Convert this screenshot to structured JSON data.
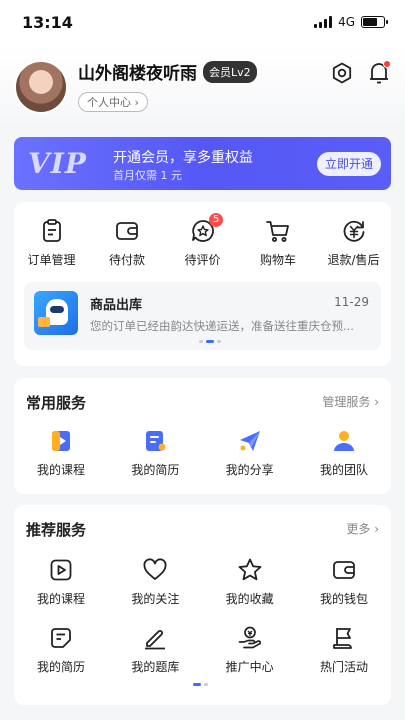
{
  "status_bar": {
    "time": "13:14",
    "network": "4G"
  },
  "profile": {
    "username": "山外阁楼夜听雨",
    "level_badge": "会员Lv2",
    "center_link": "个人中心 ›"
  },
  "vip_banner": {
    "logo": "VIP",
    "title": "开通会员，享多重权益",
    "subtitle": "首月仅需 1 元",
    "button": "立即开通"
  },
  "orders": {
    "items": [
      {
        "label": "订单管理",
        "icon": "clipboard-icon"
      },
      {
        "label": "待付款",
        "icon": "wallet-icon"
      },
      {
        "label": "待评价",
        "icon": "review-star-icon",
        "badge": "5"
      },
      {
        "label": "购物车",
        "icon": "cart-icon"
      },
      {
        "label": "退款/售后",
        "icon": "refund-icon"
      }
    ],
    "logistics": {
      "title": "商品出库",
      "date": "11-29",
      "text": "您的订单已经由韵达快递运送，准备送往重庆仓预..."
    }
  },
  "common_services": {
    "title": "常用服务",
    "more": "管理服务 ›",
    "items": [
      {
        "label": "我的课程",
        "icon": "course-icon"
      },
      {
        "label": "我的简历",
        "icon": "resume-icon"
      },
      {
        "label": "我的分享",
        "icon": "share-plane-icon"
      },
      {
        "label": "我的团队",
        "icon": "team-icon"
      }
    ]
  },
  "recommended_services": {
    "title": "推荐服务",
    "more": "更多 ›",
    "items": [
      {
        "label": "我的课程",
        "icon": "play-icon"
      },
      {
        "label": "我的关注",
        "icon": "heart-icon"
      },
      {
        "label": "我的收藏",
        "icon": "star-icon"
      },
      {
        "label": "我的钱包",
        "icon": "wallet-icon"
      },
      {
        "label": "我的简历",
        "icon": "resume-icon"
      },
      {
        "label": "我的题库",
        "icon": "pen-icon"
      },
      {
        "label": "推广中心",
        "icon": "promo-hand-icon"
      },
      {
        "label": "热门活动",
        "icon": "flag-icon"
      }
    ]
  },
  "colors": {
    "accent": "#3b6cff",
    "vip_banner": "#5a5df6",
    "badge_red": "#ff4d4f"
  }
}
